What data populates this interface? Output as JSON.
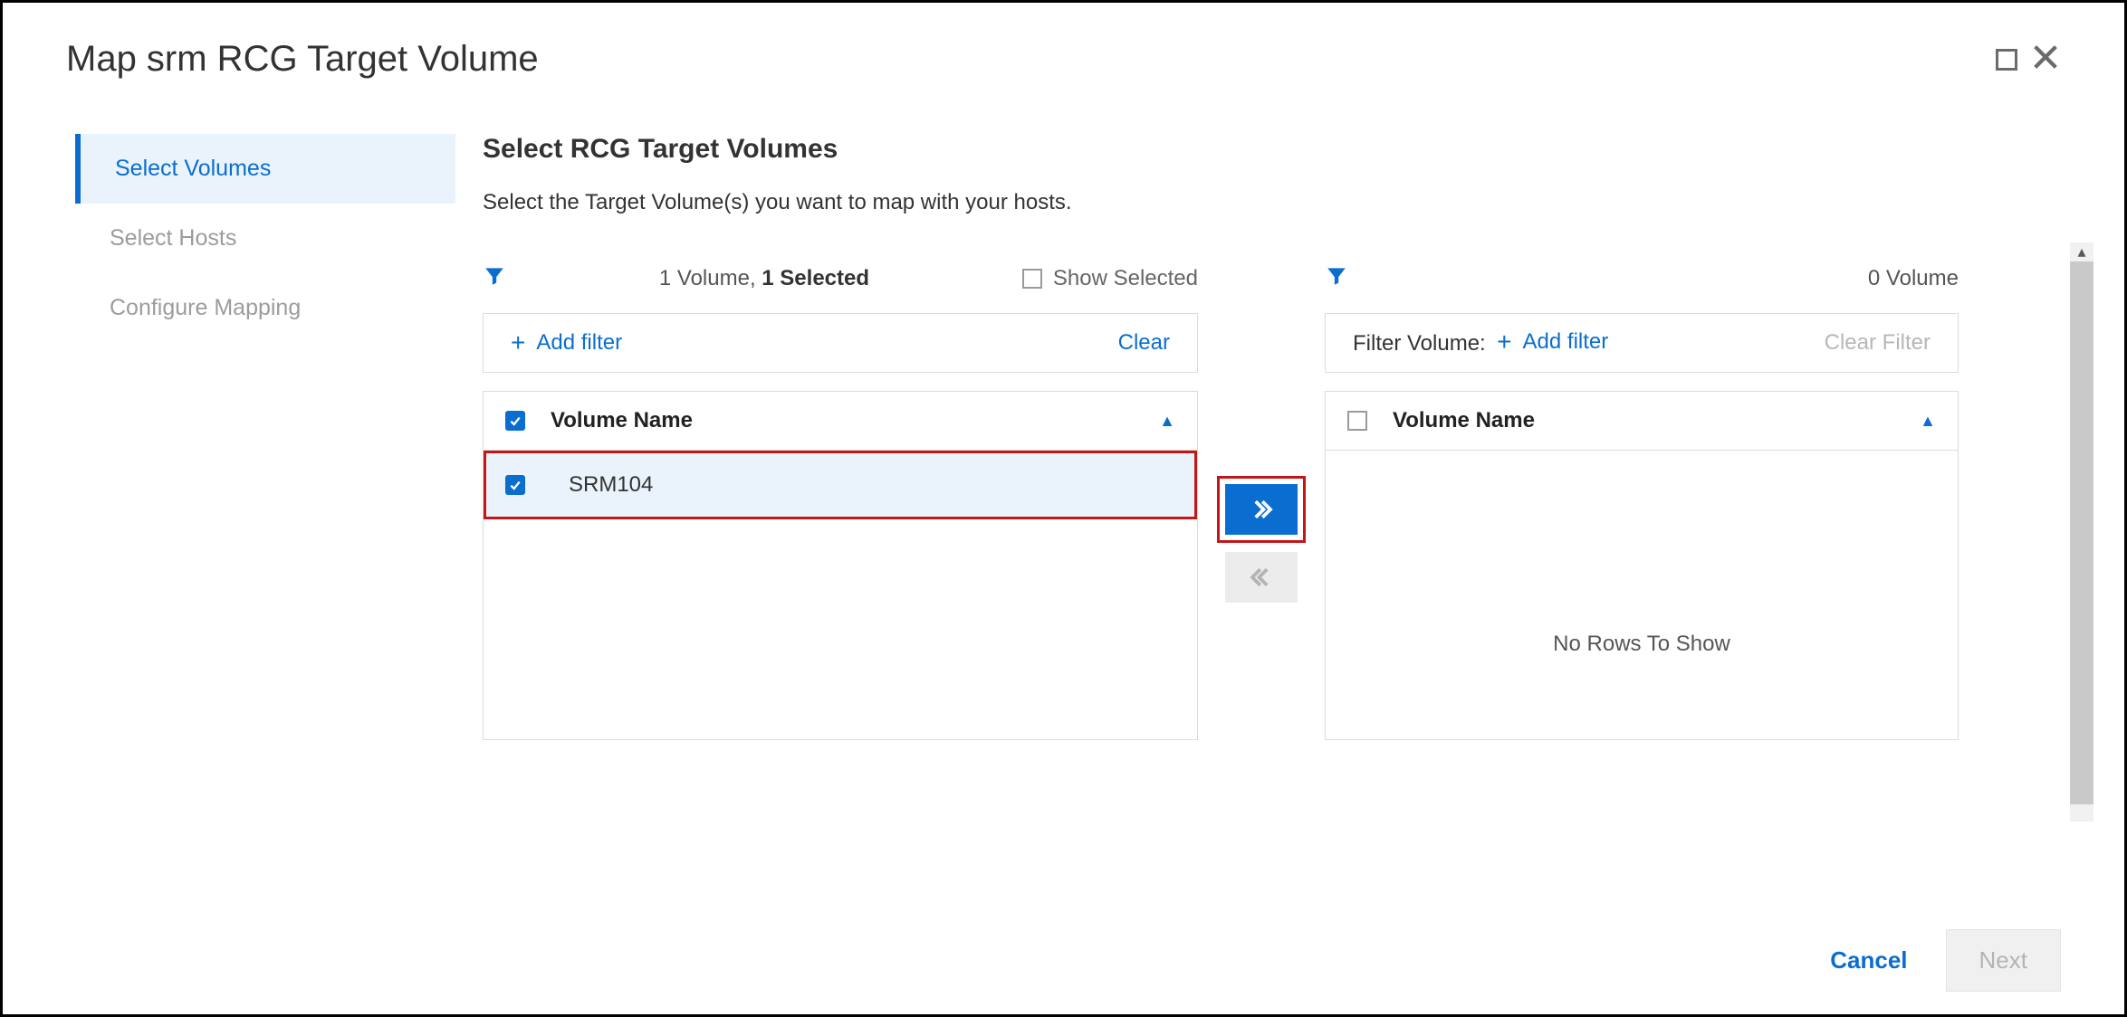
{
  "dialog": {
    "title": "Map srm RCG Target Volume"
  },
  "wizard": {
    "steps": [
      {
        "label": "Select Volumes",
        "state": "active"
      },
      {
        "label": "Select Hosts",
        "state": "disabled"
      },
      {
        "label": "Configure Mapping",
        "state": "disabled"
      }
    ]
  },
  "main": {
    "title": "Select RCG Target Volumes",
    "description": "Select the Target Volume(s) you want to map with your hosts."
  },
  "leftPane": {
    "count_text_prefix": "1 Volume, ",
    "count_text_bold": "1 Selected",
    "show_selected_label": "Show Selected",
    "add_filter_label": "Add filter",
    "clear_label": "Clear",
    "column_header": "Volume Name",
    "rows": [
      {
        "name": "SRM104",
        "selected": true
      }
    ]
  },
  "rightPane": {
    "count_text": "0 Volume",
    "filter_label": "Filter Volume:",
    "add_filter_label": "Add filter",
    "clear_label": "Clear Filter",
    "column_header": "Volume Name",
    "empty_message": "No Rows To Show"
  },
  "footer": {
    "cancel_label": "Cancel",
    "next_label": "Next"
  }
}
